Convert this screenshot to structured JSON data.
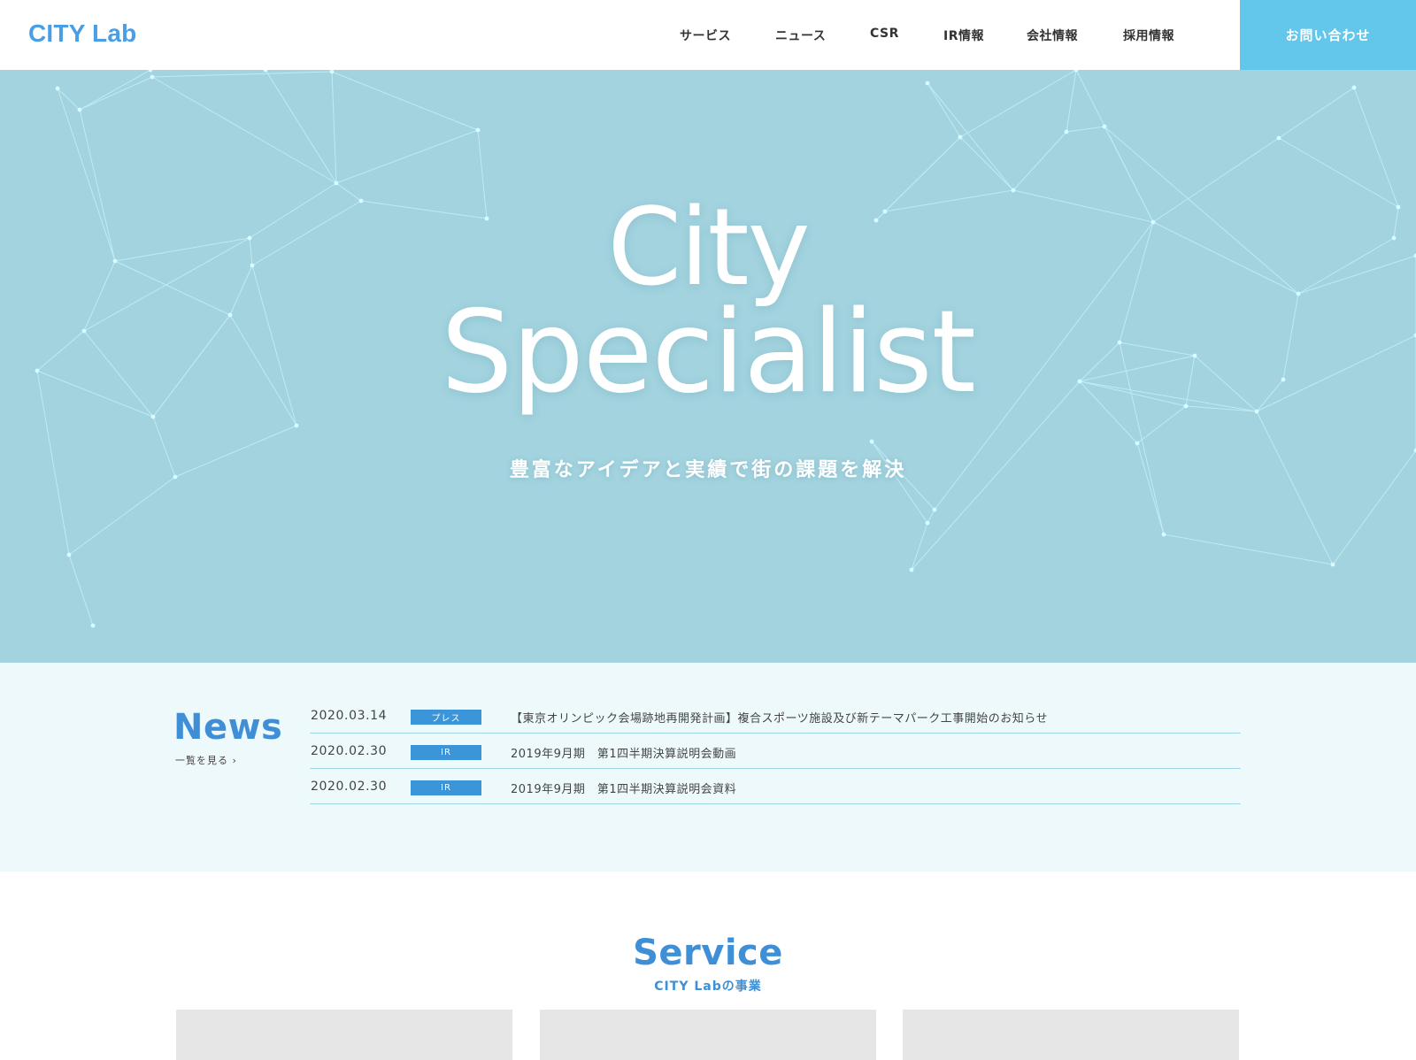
{
  "header": {
    "logo": "CITY Lab",
    "nav": [
      {
        "label": "サービス"
      },
      {
        "label": "ニュース"
      },
      {
        "label": "CSR"
      },
      {
        "label": "IR情報"
      },
      {
        "label": "会社情報"
      },
      {
        "label": "採用情報"
      }
    ],
    "contact_label": "お問い合わせ"
  },
  "hero": {
    "title_line1": "City",
    "title_line2": "Specialist",
    "subtitle": "豊富なアイデアと実績で街の課題を解決",
    "background_color": "#a2d3df",
    "line_color": "#c9f4fb"
  },
  "news": {
    "heading": "News",
    "more_link": "一覧を見る ›",
    "items": [
      {
        "date": "2020.03.14",
        "tag": "プレス",
        "title": "【東京オリンピック会場跡地再開発計画】複合スポーツ施設及び新テーマパーク工事開始のお知らせ"
      },
      {
        "date": "2020.02.30",
        "tag": "IR",
        "title": "2019年9月期　第1四半期決算説明会動画"
      },
      {
        "date": "2020.02.30",
        "tag": "IR",
        "title": "2019年9月期　第1四半期決算説明会資料"
      }
    ]
  },
  "service": {
    "heading": "Service",
    "subheading": "CITY Labの事業"
  },
  "colors": {
    "brand": "#4a9ee3",
    "accent": "#62c7ea",
    "heading_blue": "#3f8fd6",
    "tag_blue": "#3b95d8",
    "news_bg": "#eef9fc",
    "card_gray": "#e6e6e6"
  }
}
